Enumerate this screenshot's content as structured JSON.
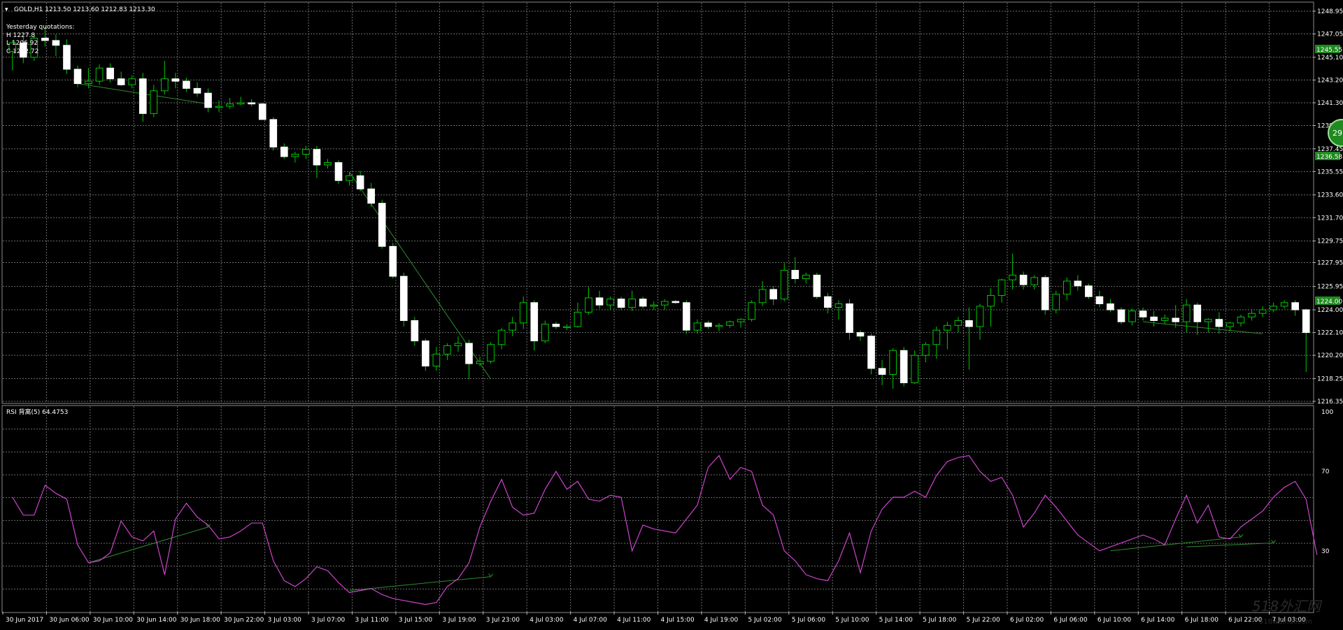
{
  "header": {
    "symbol_label": "GOLD,H1  1213.50 1213.60 1212.83 1213.30",
    "yesterday_title": "Yesterday quotations:",
    "yesterday_high": "H 1227.8",
    "yesterday_low": "L 1206.92",
    "yesterday_close": "C 1212.72"
  },
  "rsi_header": {
    "label": "RSI 背离(5) 64.4753"
  },
  "price_axis": {
    "ticks": [
      "1248.95",
      "1247.05",
      "1245.10",
      "1243.20",
      "1241.30",
      "1239.40",
      "1237.45",
      "1235.55",
      "1233.60",
      "1231.70",
      "1229.75",
      "1227.95",
      "1225.95",
      "1224.00",
      "1222.10",
      "1220.20",
      "1218.25",
      "1216.35"
    ],
    "tag_current": "1245.55",
    "tag_mid": "1236.58",
    "tag_low": "1224.00",
    "circle_badge": "29"
  },
  "rsi_axis": {
    "ticks": [
      "100",
      "70",
      "30"
    ]
  },
  "time_axis": {
    "labels": [
      "30 Jun 2017",
      "30 Jun 06:00",
      "30 Jun 10:00",
      "30 Jun 14:00",
      "30 Jun 18:00",
      "30 Jun 22:00",
      "3 Jul 03:00",
      "3 Jul 07:00",
      "3 Jul 11:00",
      "3 Jul 15:00",
      "3 Jul 19:00",
      "3 Jul 23:00",
      "4 Jul 03:00",
      "4 Jul 07:00",
      "4 Jul 11:00",
      "4 Jul 15:00",
      "4 Jul 19:00",
      "5 Jul 02:00",
      "5 Jul 06:00",
      "5 Jul 10:00",
      "5 Jul 14:00",
      "5 Jul 18:00",
      "5 Jul 22:00",
      "6 Jul 02:00",
      "6 Jul 06:00",
      "6 Jul 10:00",
      "6 Jul 14:00",
      "6 Jul 18:00",
      "6 Jul 22:00",
      "7 Jul 03:00"
    ]
  },
  "watermark": {
    "main": "518外汇网",
    "sub": "518waihui.com"
  },
  "colors": {
    "background": "#000000",
    "grid": "#6e6e6e",
    "candle_up": "#000000",
    "candle_down": "#ffffff",
    "wick": "#00c800",
    "rsi_line": "#cc44cc",
    "divergence": "#2e8b2e",
    "tag_green": "#1f8a1f"
  },
  "chart_data": {
    "type": "candlestick",
    "instrument": "GOLD",
    "timeframe": "H1",
    "ylim": [
      1216.35,
      1248.95
    ],
    "candles": [
      {
        "o": 1245.6,
        "h": 1246.5,
        "l": 1244.0,
        "c": 1246.3
      },
      {
        "o": 1246.3,
        "h": 1246.8,
        "l": 1244.6,
        "c": 1245.1
      },
      {
        "o": 1245.1,
        "h": 1247.0,
        "l": 1244.8,
        "c": 1246.7
      },
      {
        "o": 1246.7,
        "h": 1247.6,
        "l": 1246.0,
        "c": 1246.5
      },
      {
        "o": 1246.5,
        "h": 1247.0,
        "l": 1245.2,
        "c": 1246.1
      },
      {
        "o": 1246.1,
        "h": 1246.6,
        "l": 1243.7,
        "c": 1244.1
      },
      {
        "o": 1244.1,
        "h": 1244.4,
        "l": 1242.6,
        "c": 1242.9
      },
      {
        "o": 1242.9,
        "h": 1244.2,
        "l": 1242.5,
        "c": 1243.1
      },
      {
        "o": 1243.1,
        "h": 1244.5,
        "l": 1242.8,
        "c": 1244.2
      },
      {
        "o": 1244.2,
        "h": 1244.6,
        "l": 1243.0,
        "c": 1243.3
      },
      {
        "o": 1243.3,
        "h": 1243.9,
        "l": 1242.7,
        "c": 1242.8
      },
      {
        "o": 1242.8,
        "h": 1243.6,
        "l": 1242.5,
        "c": 1243.3
      },
      {
        "o": 1243.3,
        "h": 1243.8,
        "l": 1239.7,
        "c": 1240.4
      },
      {
        "o": 1240.4,
        "h": 1242.8,
        "l": 1240.1,
        "c": 1242.3
      },
      {
        "o": 1242.3,
        "h": 1244.8,
        "l": 1242.0,
        "c": 1243.3
      },
      {
        "o": 1243.3,
        "h": 1243.8,
        "l": 1242.5,
        "c": 1243.1
      },
      {
        "o": 1243.1,
        "h": 1243.4,
        "l": 1242.2,
        "c": 1242.5
      },
      {
        "o": 1242.5,
        "h": 1243.0,
        "l": 1241.8,
        "c": 1242.1
      },
      {
        "o": 1242.1,
        "h": 1242.5,
        "l": 1240.5,
        "c": 1240.9
      },
      {
        "o": 1240.9,
        "h": 1241.5,
        "l": 1240.5,
        "c": 1241.0
      },
      {
        "o": 1241.0,
        "h": 1241.7,
        "l": 1240.8,
        "c": 1241.2
      },
      {
        "o": 1241.2,
        "h": 1241.8,
        "l": 1241.1,
        "c": 1241.3
      },
      {
        "o": 1241.3,
        "h": 1241.6,
        "l": 1241.0,
        "c": 1241.2
      },
      {
        "o": 1241.2,
        "h": 1241.3,
        "l": 1239.9,
        "c": 1239.9
      },
      {
        "o": 1239.9,
        "h": 1240.1,
        "l": 1237.3,
        "c": 1237.6
      },
      {
        "o": 1237.6,
        "h": 1237.9,
        "l": 1236.6,
        "c": 1236.8
      },
      {
        "o": 1236.8,
        "h": 1237.2,
        "l": 1236.3,
        "c": 1237.0
      },
      {
        "o": 1237.0,
        "h": 1237.7,
        "l": 1236.6,
        "c": 1237.4
      },
      {
        "o": 1237.4,
        "h": 1237.7,
        "l": 1235.0,
        "c": 1236.1
      },
      {
        "o": 1236.1,
        "h": 1236.6,
        "l": 1235.8,
        "c": 1236.3
      },
      {
        "o": 1236.3,
        "h": 1236.5,
        "l": 1234.5,
        "c": 1234.8
      },
      {
        "o": 1234.8,
        "h": 1235.5,
        "l": 1234.4,
        "c": 1235.2
      },
      {
        "o": 1235.2,
        "h": 1235.6,
        "l": 1233.9,
        "c": 1234.1
      },
      {
        "o": 1234.1,
        "h": 1234.6,
        "l": 1232.6,
        "c": 1232.9
      },
      {
        "o": 1232.9,
        "h": 1233.2,
        "l": 1229.1,
        "c": 1229.3
      },
      {
        "o": 1229.3,
        "h": 1229.6,
        "l": 1226.6,
        "c": 1226.8
      },
      {
        "o": 1226.8,
        "h": 1227.1,
        "l": 1222.6,
        "c": 1223.1
      },
      {
        "o": 1223.1,
        "h": 1223.4,
        "l": 1221.0,
        "c": 1221.4
      },
      {
        "o": 1221.4,
        "h": 1221.6,
        "l": 1218.9,
        "c": 1219.3
      },
      {
        "o": 1219.3,
        "h": 1220.9,
        "l": 1218.9,
        "c": 1220.3
      },
      {
        "o": 1220.3,
        "h": 1221.2,
        "l": 1219.8,
        "c": 1221.0
      },
      {
        "o": 1221.0,
        "h": 1221.8,
        "l": 1220.5,
        "c": 1221.2
      },
      {
        "o": 1221.2,
        "h": 1221.5,
        "l": 1218.2,
        "c": 1219.5
      },
      {
        "o": 1219.5,
        "h": 1220.1,
        "l": 1219.3,
        "c": 1219.7
      },
      {
        "o": 1219.7,
        "h": 1221.3,
        "l": 1219.5,
        "c": 1221.1
      },
      {
        "o": 1221.1,
        "h": 1222.5,
        "l": 1220.7,
        "c": 1222.3
      },
      {
        "o": 1222.3,
        "h": 1223.4,
        "l": 1221.8,
        "c": 1222.9
      },
      {
        "o": 1222.9,
        "h": 1225.1,
        "l": 1222.4,
        "c": 1224.6
      },
      {
        "o": 1224.6,
        "h": 1224.8,
        "l": 1220.6,
        "c": 1221.4
      },
      {
        "o": 1221.4,
        "h": 1223.1,
        "l": 1221.2,
        "c": 1222.8
      },
      {
        "o": 1222.8,
        "h": 1223.0,
        "l": 1222.4,
        "c": 1222.6
      },
      {
        "o": 1222.6,
        "h": 1222.8,
        "l": 1222.3,
        "c": 1222.6
      },
      {
        "o": 1222.6,
        "h": 1224.6,
        "l": 1222.5,
        "c": 1223.8
      },
      {
        "o": 1223.8,
        "h": 1225.9,
        "l": 1223.6,
        "c": 1225.0
      },
      {
        "o": 1225.0,
        "h": 1225.6,
        "l": 1224.1,
        "c": 1224.4
      },
      {
        "o": 1224.4,
        "h": 1225.1,
        "l": 1224.0,
        "c": 1224.9
      },
      {
        "o": 1224.9,
        "h": 1225.1,
        "l": 1224.0,
        "c": 1224.2
      },
      {
        "o": 1224.2,
        "h": 1225.6,
        "l": 1223.9,
        "c": 1224.9
      },
      {
        "o": 1224.9,
        "h": 1225.1,
        "l": 1224.1,
        "c": 1224.3
      },
      {
        "o": 1224.3,
        "h": 1224.7,
        "l": 1224.0,
        "c": 1224.4
      },
      {
        "o": 1224.4,
        "h": 1224.9,
        "l": 1224.0,
        "c": 1224.7
      },
      {
        "o": 1224.7,
        "h": 1224.8,
        "l": 1224.5,
        "c": 1224.6
      },
      {
        "o": 1224.6,
        "h": 1224.8,
        "l": 1222.0,
        "c": 1222.3
      },
      {
        "o": 1222.3,
        "h": 1223.2,
        "l": 1222.0,
        "c": 1222.9
      },
      {
        "o": 1222.9,
        "h": 1223.1,
        "l": 1222.4,
        "c": 1222.6
      },
      {
        "o": 1222.6,
        "h": 1222.9,
        "l": 1222.2,
        "c": 1222.7
      },
      {
        "o": 1222.7,
        "h": 1223.1,
        "l": 1222.5,
        "c": 1223.0
      },
      {
        "o": 1223.0,
        "h": 1223.3,
        "l": 1222.5,
        "c": 1223.2
      },
      {
        "o": 1223.2,
        "h": 1224.8,
        "l": 1223.0,
        "c": 1224.6
      },
      {
        "o": 1224.6,
        "h": 1226.4,
        "l": 1224.3,
        "c": 1225.7
      },
      {
        "o": 1225.7,
        "h": 1226.0,
        "l": 1224.4,
        "c": 1224.9
      },
      {
        "o": 1224.9,
        "h": 1227.9,
        "l": 1224.7,
        "c": 1227.3
      },
      {
        "o": 1227.3,
        "h": 1228.4,
        "l": 1226.2,
        "c": 1226.6
      },
      {
        "o": 1226.6,
        "h": 1227.1,
        "l": 1226.2,
        "c": 1226.9
      },
      {
        "o": 1226.9,
        "h": 1227.1,
        "l": 1224.9,
        "c": 1225.1
      },
      {
        "o": 1225.1,
        "h": 1225.4,
        "l": 1223.7,
        "c": 1224.2
      },
      {
        "o": 1224.2,
        "h": 1224.8,
        "l": 1223.2,
        "c": 1224.5
      },
      {
        "o": 1224.5,
        "h": 1224.9,
        "l": 1221.5,
        "c": 1222.1
      },
      {
        "o": 1222.1,
        "h": 1222.3,
        "l": 1221.4,
        "c": 1221.8
      },
      {
        "o": 1221.8,
        "h": 1222.0,
        "l": 1218.6,
        "c": 1219.1
      },
      {
        "o": 1219.1,
        "h": 1219.8,
        "l": 1217.7,
        "c": 1218.6
      },
      {
        "o": 1218.6,
        "h": 1220.8,
        "l": 1217.4,
        "c": 1220.6
      },
      {
        "o": 1220.6,
        "h": 1220.9,
        "l": 1217.6,
        "c": 1217.9
      },
      {
        "o": 1217.9,
        "h": 1220.6,
        "l": 1217.8,
        "c": 1220.2
      },
      {
        "o": 1220.2,
        "h": 1221.3,
        "l": 1219.6,
        "c": 1221.1
      },
      {
        "o": 1221.1,
        "h": 1222.6,
        "l": 1219.9,
        "c": 1222.3
      },
      {
        "o": 1222.3,
        "h": 1223.0,
        "l": 1220.7,
        "c": 1222.7
      },
      {
        "o": 1222.7,
        "h": 1223.4,
        "l": 1222.1,
        "c": 1223.1
      },
      {
        "o": 1223.1,
        "h": 1224.2,
        "l": 1219.0,
        "c": 1222.6
      },
      {
        "o": 1222.6,
        "h": 1224.5,
        "l": 1221.5,
        "c": 1224.3
      },
      {
        "o": 1224.3,
        "h": 1225.8,
        "l": 1222.6,
        "c": 1225.2
      },
      {
        "o": 1225.2,
        "h": 1226.6,
        "l": 1224.6,
        "c": 1226.5
      },
      {
        "o": 1226.5,
        "h": 1228.7,
        "l": 1225.7,
        "c": 1226.9
      },
      {
        "o": 1226.9,
        "h": 1227.2,
        "l": 1225.7,
        "c": 1226.1
      },
      {
        "o": 1226.1,
        "h": 1226.9,
        "l": 1225.7,
        "c": 1226.7
      },
      {
        "o": 1226.7,
        "h": 1226.9,
        "l": 1223.6,
        "c": 1224.0
      },
      {
        "o": 1224.0,
        "h": 1225.6,
        "l": 1223.7,
        "c": 1225.3
      },
      {
        "o": 1225.3,
        "h": 1226.7,
        "l": 1224.8,
        "c": 1226.4
      },
      {
        "o": 1226.4,
        "h": 1226.9,
        "l": 1225.6,
        "c": 1226.0
      },
      {
        "o": 1226.0,
        "h": 1226.2,
        "l": 1224.9,
        "c": 1225.1
      },
      {
        "o": 1225.1,
        "h": 1225.6,
        "l": 1224.2,
        "c": 1224.5
      },
      {
        "o": 1224.5,
        "h": 1224.9,
        "l": 1223.8,
        "c": 1224.0
      },
      {
        "o": 1224.0,
        "h": 1224.2,
        "l": 1222.8,
        "c": 1223.0
      },
      {
        "o": 1223.0,
        "h": 1224.1,
        "l": 1222.7,
        "c": 1223.9
      },
      {
        "o": 1223.9,
        "h": 1224.2,
        "l": 1223.1,
        "c": 1223.4
      },
      {
        "o": 1223.4,
        "h": 1223.9,
        "l": 1222.6,
        "c": 1223.1
      },
      {
        "o": 1223.1,
        "h": 1223.6,
        "l": 1222.8,
        "c": 1223.3
      },
      {
        "o": 1223.3,
        "h": 1224.4,
        "l": 1222.5,
        "c": 1223.0
      },
      {
        "o": 1223.0,
        "h": 1224.9,
        "l": 1222.1,
        "c": 1224.4
      },
      {
        "o": 1224.4,
        "h": 1224.6,
        "l": 1221.9,
        "c": 1223.0
      },
      {
        "o": 1223.0,
        "h": 1223.3,
        "l": 1222.1,
        "c": 1223.2
      },
      {
        "o": 1223.2,
        "h": 1223.8,
        "l": 1222.0,
        "c": 1222.6
      },
      {
        "o": 1222.6,
        "h": 1223.0,
        "l": 1222.2,
        "c": 1222.9
      },
      {
        "o": 1222.9,
        "h": 1223.6,
        "l": 1222.6,
        "c": 1223.4
      },
      {
        "o": 1223.4,
        "h": 1224.0,
        "l": 1223.1,
        "c": 1223.7
      },
      {
        "o": 1223.7,
        "h": 1224.3,
        "l": 1223.4,
        "c": 1224.0
      },
      {
        "o": 1224.0,
        "h": 1224.6,
        "l": 1223.8,
        "c": 1224.3
      },
      {
        "o": 1224.3,
        "h": 1224.8,
        "l": 1224.1,
        "c": 1224.6
      },
      {
        "o": 1224.6,
        "h": 1224.8,
        "l": 1223.5,
        "c": 1224.0
      },
      {
        "o": 1224.0,
        "h": 1224.1,
        "l": 1218.8,
        "c": 1222.1
      }
    ],
    "rsi": {
      "name": "RSI 背离(5)",
      "ylim": [
        0,
        100
      ],
      "levels": [
        30,
        70
      ],
      "values": [
        57,
        48,
        48,
        63,
        59,
        56,
        33,
        24,
        25,
        29,
        45,
        37,
        35,
        40,
        18,
        46,
        54,
        47,
        43,
        36,
        37,
        40,
        44,
        44,
        25,
        15,
        12,
        16,
        22,
        20,
        14,
        9,
        10,
        11,
        8,
        6,
        5,
        4,
        3,
        4,
        12,
        16,
        24,
        42,
        55,
        66,
        52,
        48,
        49,
        61,
        70,
        61,
        65,
        56,
        55,
        58,
        57,
        30,
        43,
        41,
        40,
        39,
        46,
        53,
        72,
        78,
        66,
        72,
        70,
        53,
        48,
        30,
        25,
        18,
        16,
        15,
        25,
        39,
        19,
        40,
        51,
        57,
        57,
        60,
        57,
        68,
        75,
        77,
        78,
        70,
        65,
        67,
        58,
        42,
        49,
        58,
        52,
        45,
        38,
        34,
        30,
        32,
        34,
        36,
        38,
        36,
        33,
        46,
        58,
        44,
        53,
        37,
        36,
        42,
        46,
        50,
        57,
        62,
        65,
        56,
        28
      ]
    },
    "divergence_lines": [
      {
        "i1": 6,
        "v1": 1242.9,
        "i2": 18,
        "v2": 1241.2,
        "pane": "price"
      },
      {
        "i1": 31,
        "v1": 1235.5,
        "i2": 44,
        "v2": 1218.2,
        "pane": "price"
      },
      {
        "i1": 104,
        "v1": 1223.0,
        "i2": 115,
        "v2": 1222.0,
        "pane": "price"
      },
      {
        "i1": 7,
        "v1": 24,
        "i2": 18,
        "v2": 42,
        "pane": "rsi"
      },
      {
        "i1": 31,
        "v1": 10,
        "i2": 44,
        "v2": 17,
        "pane": "rsi"
      },
      {
        "i1": 101,
        "v1": 30,
        "i2": 113,
        "v2": 37,
        "pane": "rsi"
      },
      {
        "i1": 108,
        "v1": 32,
        "i2": 116,
        "v2": 34,
        "pane": "rsi"
      }
    ]
  }
}
